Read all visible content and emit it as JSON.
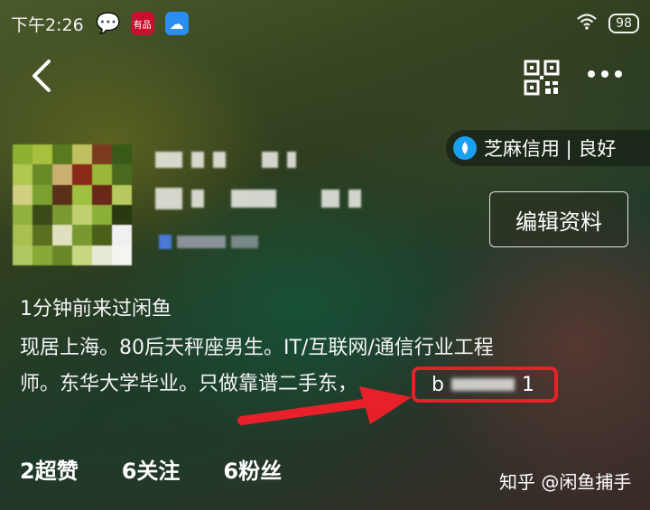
{
  "status_bar": {
    "time": "下午2:26",
    "apps": [
      "wechat-icon",
      "youpin-icon",
      "cloud-icon"
    ],
    "youpin_label": "有品",
    "battery": "98"
  },
  "nav": {
    "back_icon": "chevron-left-icon",
    "qr_icon": "qr-code-icon",
    "more_icon": "more-dots-icon"
  },
  "credit_badge": {
    "label": "芝麻信用 | 良好"
  },
  "profile": {
    "edit_button": "编辑资料",
    "last_seen": "1分钟前来过闲鱼",
    "bio_line1": "现居上海。80后天秤座男生。IT/互联网/通信行业工程",
    "bio_line2": "师。东华大学毕业。只做靠谱二手东，",
    "highlight_prefix": "b",
    "highlight_suffix": "1"
  },
  "stats": [
    {
      "label": "2超赞"
    },
    {
      "label": "6关注"
    },
    {
      "label": "6粉丝"
    }
  ],
  "watermark": "知乎 @闲鱼捕手",
  "colors": {
    "highlight_red": "#e8202a",
    "zhima_blue": "#1aa0f0"
  }
}
